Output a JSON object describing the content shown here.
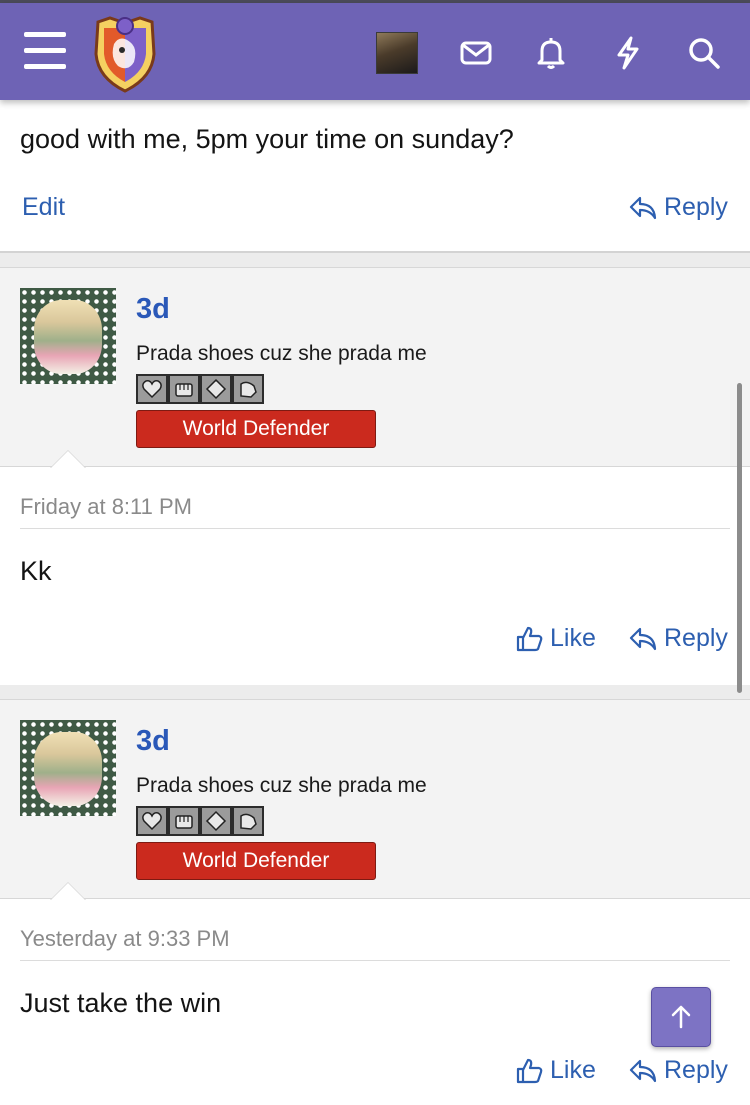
{
  "header": {
    "menu_icon": "hamburger-icon",
    "logo": "forum-shield-logo",
    "icons": [
      "envelope-icon",
      "bell-icon",
      "lightning-icon",
      "search-icon"
    ]
  },
  "top_post": {
    "text": "good with me, 5pm your time on sunday?",
    "edit_label": "Edit",
    "reply_label": "Reply"
  },
  "posts": [
    {
      "username": "3d",
      "user_title": "Prada shoes cuz she prada me",
      "rank": "World Defender",
      "timestamp": "Friday at 8:11 PM",
      "text": "Kk",
      "like_label": "Like",
      "reply_label": "Reply"
    },
    {
      "username": "3d",
      "user_title": "Prada shoes cuz she prada me",
      "rank": "World Defender",
      "timestamp": "Yesterday at 9:33 PM",
      "text": "Just take the win",
      "like_label": "Like",
      "reply_label": "Reply"
    }
  ],
  "colors": {
    "header_bg": "#6e63b5",
    "link": "#2d5fb0",
    "username": "#2a58b8",
    "rank_badge": "#cb2a1e",
    "scroll_button": "#7d73c4"
  }
}
